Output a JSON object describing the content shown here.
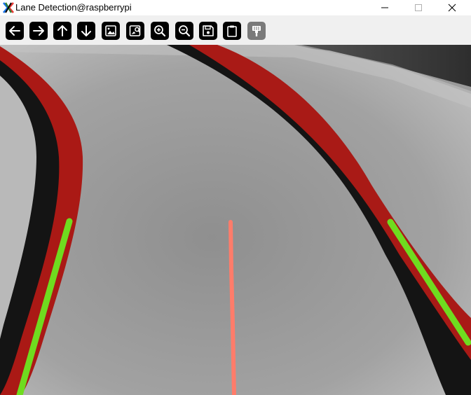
{
  "window": {
    "title": "Lane Detection@raspberrypi",
    "app_icon": "x-logo-icon",
    "controls": [
      "minimize-icon",
      "maximize-icon",
      "close-icon"
    ]
  },
  "toolbar": {
    "buttons": [
      {
        "name": "pan-left",
        "icon": "arrow-left-icon",
        "enabled": true
      },
      {
        "name": "pan-right",
        "icon": "arrow-right-icon",
        "enabled": true
      },
      {
        "name": "pan-up",
        "icon": "arrow-up-icon",
        "enabled": true
      },
      {
        "name": "pan-down",
        "icon": "arrow-down-icon",
        "enabled": true
      },
      {
        "name": "zoom-image",
        "icon": "image-icon",
        "enabled": true
      },
      {
        "name": "zoom-in-image",
        "icon": "image-search-icon",
        "enabled": true
      },
      {
        "name": "zoom-in",
        "icon": "zoom-in-icon",
        "enabled": true
      },
      {
        "name": "zoom-out",
        "icon": "zoom-out-icon",
        "enabled": true
      },
      {
        "name": "save",
        "icon": "save-icon",
        "enabled": true
      },
      {
        "name": "copy-to-clipboard",
        "icon": "clipboard-icon",
        "enabled": true
      },
      {
        "name": "properties",
        "icon": "paint-brush-icon",
        "enabled": false
      }
    ]
  },
  "colors": {
    "track_red": "#b01a16",
    "track_black": "#141414",
    "lane_marker": "#6fdc1f",
    "center_line": "#ff7c6a",
    "background_carpet": "#3a3a3a",
    "paper": "#b8b8b8"
  }
}
